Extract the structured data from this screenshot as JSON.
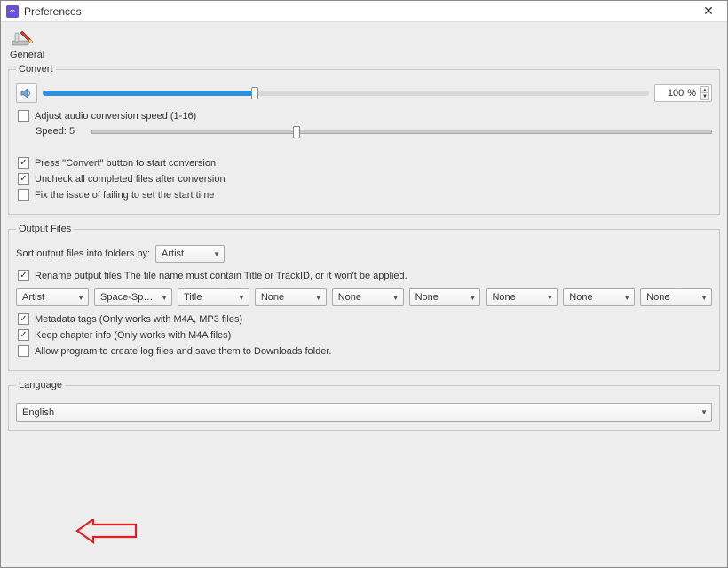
{
  "titlebar": {
    "title": "Preferences"
  },
  "general": {
    "label": "General"
  },
  "convert": {
    "legend": "Convert",
    "volume": {
      "percent": 35,
      "value": "100",
      "suffix": "%"
    },
    "adjust_speed": {
      "checked": false,
      "label": "Adjust audio conversion speed (1-16)"
    },
    "speed": {
      "label": "Speed:",
      "value": "5",
      "percent": 33
    },
    "press_convert": {
      "checked": true,
      "label": "Press \"Convert\" button to start conversion"
    },
    "uncheck_completed": {
      "checked": true,
      "label": "Uncheck all completed files after conversion"
    },
    "fix_start_time": {
      "checked": false,
      "label": "Fix the issue of failing to set the start time"
    }
  },
  "output": {
    "legend": "Output Files",
    "sort_label": "Sort output files into folders by:",
    "sort_value": "Artist",
    "rename": {
      "checked": true,
      "label": "Rename output files.The file name must contain Title or TrackID, or it won't be applied."
    },
    "fields": {
      "f0": "Artist",
      "sep": "Space-Space",
      "f1": "Title",
      "f2": "None",
      "f3": "None",
      "f4": "None",
      "f5": "None",
      "f6": "None",
      "f7": "None"
    },
    "metadata": {
      "checked": true,
      "label": "Metadata tags (Only works with M4A, MP3 files)"
    },
    "chapter": {
      "checked": true,
      "label": "Keep chapter info (Only works with M4A files)"
    },
    "log": {
      "checked": false,
      "label": "Allow program to create log files and save them to Downloads folder."
    }
  },
  "language": {
    "legend": "Language",
    "value": "English"
  }
}
